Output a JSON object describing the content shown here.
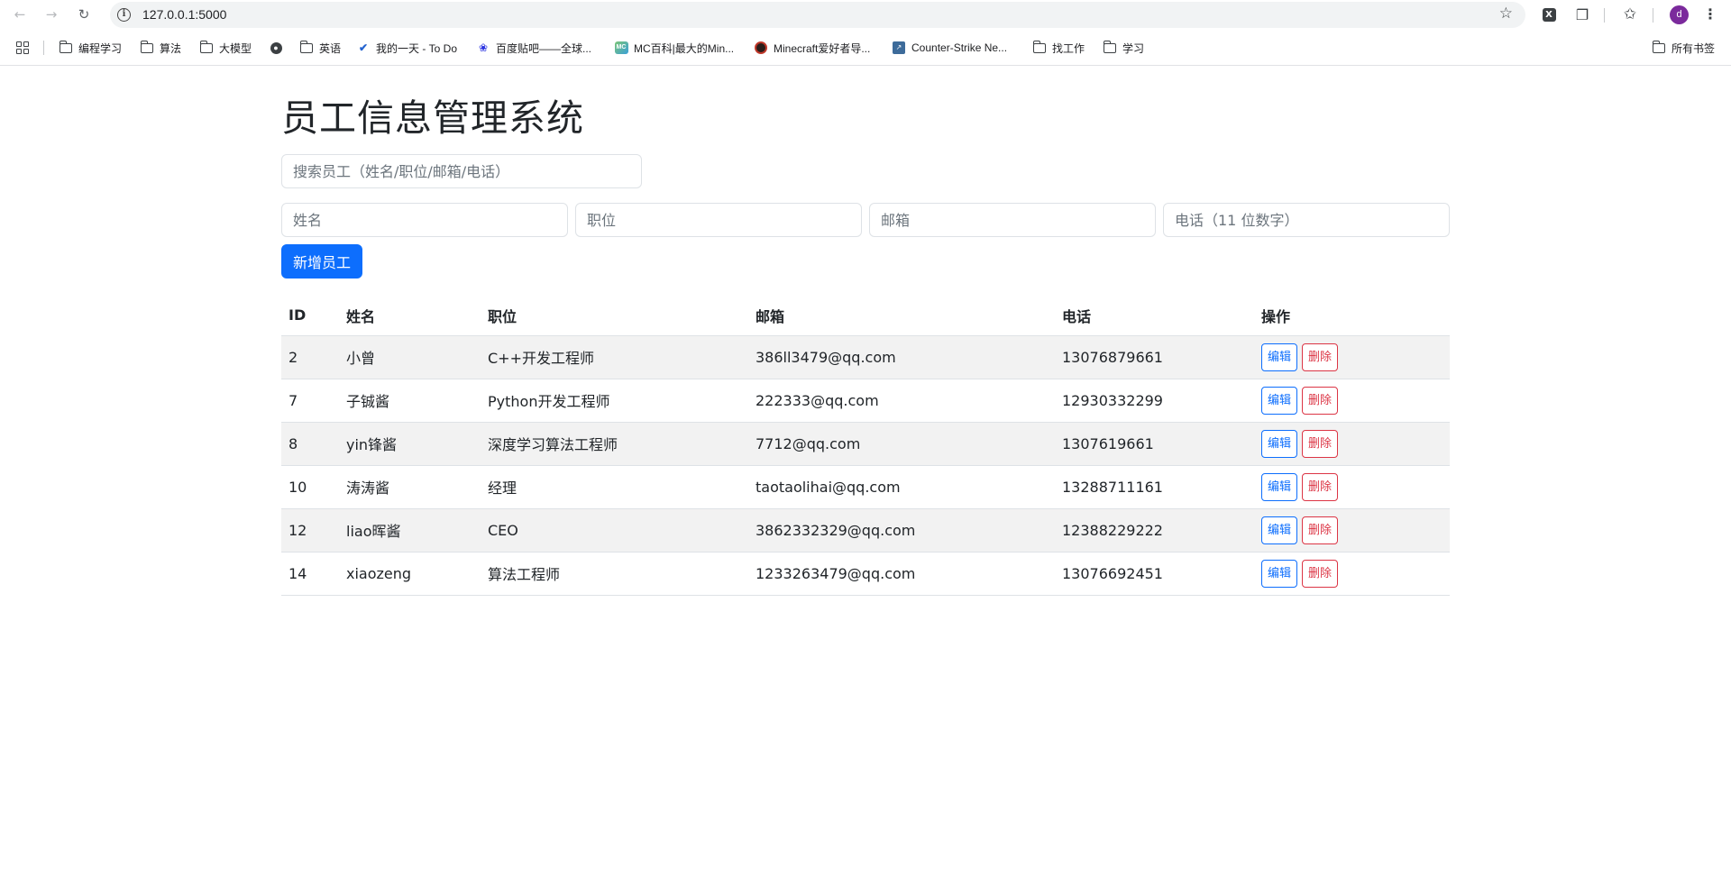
{
  "browser": {
    "url": "127.0.0.1:5000",
    "avatar_letter": "d",
    "bookmarks": [
      {
        "label": "编程学习",
        "icon": "folder-icon"
      },
      {
        "label": "算法",
        "icon": "folder-icon"
      },
      {
        "label": "大模型",
        "icon": "folder-icon"
      },
      {
        "label": "",
        "icon": "globe-icon"
      },
      {
        "label": "英语",
        "icon": "folder-icon"
      },
      {
        "label": "我的一天 - To Do",
        "icon": "check-icon"
      },
      {
        "label": "百度贴吧——全球...",
        "icon": "baidu-icon"
      },
      {
        "label": "MC百科|最大的Min...",
        "icon": "mc-icon"
      },
      {
        "label": "Minecraft爱好者导...",
        "icon": "minecraft-icon"
      },
      {
        "label": "Counter-Strike Ne...",
        "icon": "cs-icon"
      },
      {
        "label": "找工作",
        "icon": "folder-icon"
      },
      {
        "label": "学习",
        "icon": "folder-icon"
      }
    ],
    "all_bookmarks": "所有书签"
  },
  "page": {
    "title": "员工信息管理系统",
    "search_placeholder": "搜索员工（姓名/职位/邮箱/电话）",
    "form": {
      "name_placeholder": "姓名",
      "position_placeholder": "职位",
      "email_placeholder": "邮箱",
      "phone_placeholder": "电话（11 位数字）",
      "add_button": "新增员工"
    },
    "table": {
      "headers": [
        "ID",
        "姓名",
        "职位",
        "邮箱",
        "电话",
        "操作"
      ],
      "edit_label": "编辑",
      "delete_label": "删除",
      "rows": [
        {
          "id": "2",
          "name": "小曾",
          "position": "C++开发工程师",
          "email": "386ll3479@qq.com",
          "phone": "13076879661"
        },
        {
          "id": "7",
          "name": "子铖酱",
          "position": "Python开发工程师",
          "email": "222333@qq.com",
          "phone": "12930332299"
        },
        {
          "id": "8",
          "name": "yin锋酱",
          "position": "深度学习算法工程师",
          "email": "7712@qq.com",
          "phone": "1307619661"
        },
        {
          "id": "10",
          "name": "涛涛酱",
          "position": "经理",
          "email": "taotaolihai@qq.com",
          "phone": "13288711161"
        },
        {
          "id": "12",
          "name": "liao晖酱",
          "position": "CEO",
          "email": "3862332329@qq.com",
          "phone": "12388229222"
        },
        {
          "id": "14",
          "name": "xiaozeng",
          "position": "算法工程师",
          "email": "1233263479@qq.com",
          "phone": "13076692451"
        }
      ]
    }
  },
  "colors": {
    "primary": "#0d6efd",
    "danger": "#dc3545",
    "stripe": "#f2f2f2"
  }
}
